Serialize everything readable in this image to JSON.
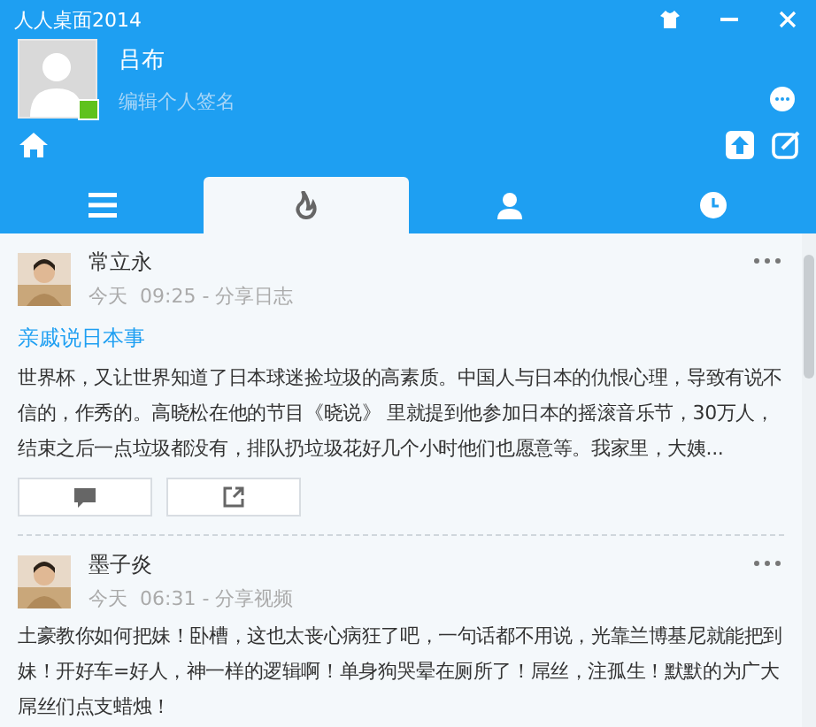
{
  "window": {
    "title": "人人桌面2014",
    "online": true
  },
  "profile": {
    "name": "吕布",
    "signature_placeholder": "编辑个人签名"
  },
  "tabs": [
    {
      "kind": "menu",
      "selected": false
    },
    {
      "kind": "flame",
      "selected": true
    },
    {
      "kind": "person",
      "selected": false
    },
    {
      "kind": "clock",
      "selected": false
    }
  ],
  "posts": [
    {
      "author": "常立永",
      "day": "今天",
      "meta": "09:25 - 分享日志",
      "title": "亲戚说日本事",
      "body": "世界杯，又让世界知道了日本球迷捡垃圾的高素质。中国人与日本的仇恨心理，导致有说不信的，作秀的。高晓松在他的节目《晓说》 里就提到他参加日本的摇滚音乐节，30万人，结束之后一点垃圾都没有，排队扔垃圾花好几个小时他们也愿意等。我家里，大姨...",
      "actions": true
    },
    {
      "author": "墨子炎",
      "day": "今天",
      "meta": "06:31 - 分享视频",
      "body": "土豪教你如何把妹！卧槽，这也太丧心病狂了吧，一句话都不用说，光靠兰博基尼就能把到妹！开好车=好人，神一样的逻辑啊！单身狗哭晕在厕所了！屌丝，注孤生！默默的为广大屌丝们点支蜡烛！",
      "actions": false
    }
  ]
}
